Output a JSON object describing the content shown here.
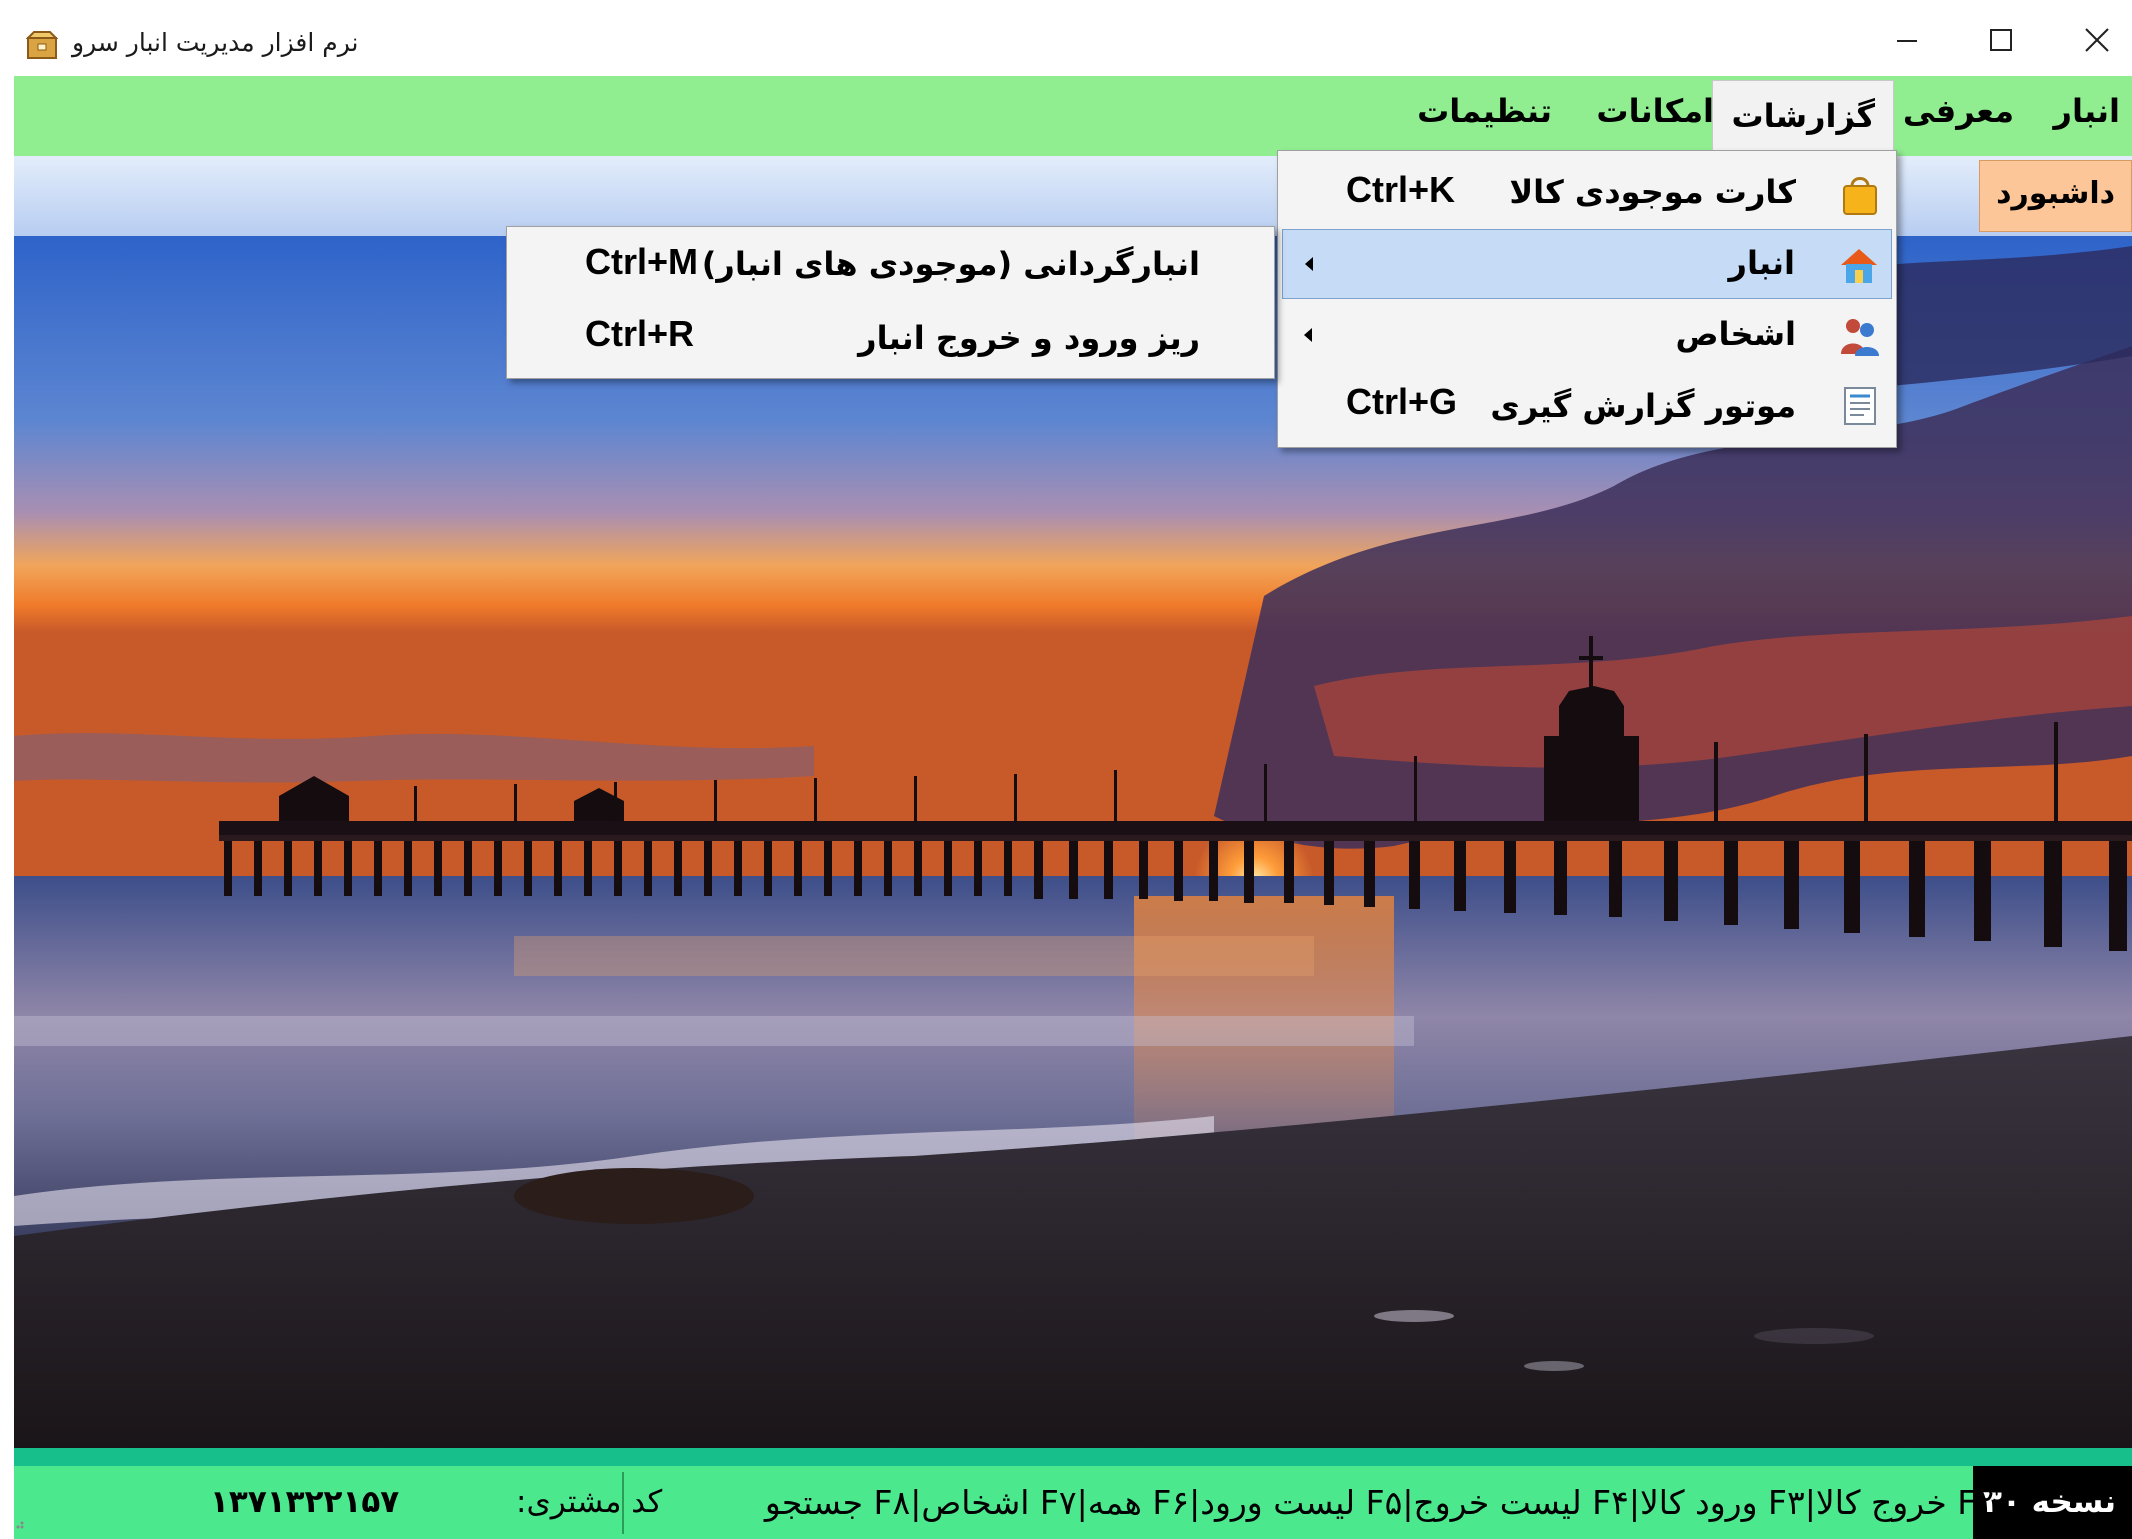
{
  "window": {
    "title": "نرم افزار مدیریت انبار سرو",
    "app_icon": "warehouse-box-icon",
    "controls": [
      "minimize-icon",
      "maximize-icon",
      "close-icon"
    ]
  },
  "menubar": {
    "background": "#90ee90",
    "items": [
      {
        "label": "انبار"
      },
      {
        "label": "معرفی"
      },
      {
        "label": "گزارشات",
        "active": true
      },
      {
        "label": "امکانات"
      },
      {
        "label": "تنظیمات"
      }
    ]
  },
  "tabs": {
    "dashboard_label": "داشبورد",
    "dashboard_color": "#fcc698"
  },
  "reports_menu": {
    "items": [
      {
        "label": "کارت موجودی کالا",
        "shortcut": "Ctrl+K",
        "icon": "shopping-bag-icon"
      },
      {
        "label": "انبار",
        "icon": "warehouse-house-icon",
        "has_submenu": true,
        "highlighted": true
      },
      {
        "label": "اشخاص",
        "icon": "people-icon",
        "has_submenu": true
      },
      {
        "label": "موتور گزارش گیری",
        "shortcut": "Ctrl+G",
        "icon": "report-document-icon"
      }
    ]
  },
  "warehouse_submenu": {
    "items": [
      {
        "label": "انبارگردانی (موجودی های انبار)",
        "shortcut": "Ctrl+M"
      },
      {
        "label": "ریز ورود و خروج انبار",
        "shortcut": "Ctrl+R"
      }
    ]
  },
  "wallpaper": {
    "description_icon": "sunset-pier-wallpaper"
  },
  "statusbar": {
    "version": "نسخه ۳۰",
    "shortcut_hints": "F۲ خروج کالا|F۳ ورود کالا|F۴ لیست خروج|F۵ لیست ورود|F۶ همه|F۷ اشخاص|F۸ جستجو",
    "customer_code_label": "کد مشتری:",
    "customer_code_value": "۱۳۷۱۳۲۲۱۵۷",
    "background": "#4ce88e"
  }
}
